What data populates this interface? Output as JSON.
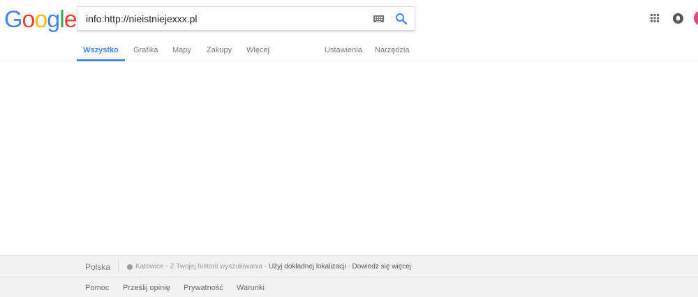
{
  "logo": {
    "letters": [
      "G",
      "o",
      "o",
      "g",
      "l",
      "e"
    ],
    "colors": [
      "#4285f4",
      "#ea4335",
      "#fbbc05",
      "#4285f4",
      "#34a853",
      "#ea4335"
    ]
  },
  "search": {
    "query": "info:http://nieistniejexxx.pl",
    "icons": {
      "keyboard": "keyboard-icon",
      "search": "search-icon"
    }
  },
  "header_right": {
    "icons": [
      "apps-grid-icon",
      "notifications-icon",
      "account-avatar"
    ]
  },
  "tabs": {
    "all": "Wszystko",
    "images": "Grafika",
    "maps": "Mapy",
    "shopping": "Zakupy",
    "more": "Więcej",
    "settings": "Ustawienia",
    "tools": "Narzędzia"
  },
  "footer": {
    "country": "Polska",
    "location_text": "Katowice - Z Twojej historii wyszukiwania",
    "dash1": " - ",
    "use_precise": "Użyj dokładnej lokalizacji",
    "dash2": " - ",
    "learn_more": "Dowiedz się więcej",
    "links": {
      "help": "Pomoc",
      "feedback": "Prześlij opinię",
      "privacy": "Prywatność",
      "terms": "Warunki"
    }
  },
  "colors": {
    "accent": "#4285f4",
    "footer_bg": "#f2f2f2",
    "avatar": "#e8457a"
  }
}
